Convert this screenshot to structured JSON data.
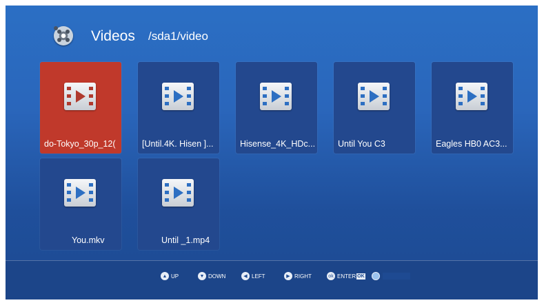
{
  "header": {
    "app_title": "Videos",
    "path": "/sda1/video",
    "logo_icon": "film-reel-icon"
  },
  "files": [
    {
      "name": "do-Tokyo_30p_12(",
      "selected": true
    },
    {
      "name": "[Until.4K. Hisen ]...",
      "selected": false
    },
    {
      "name": "Hisense_4K_HDc...",
      "selected": false
    },
    {
      "name": "Until You C3",
      "selected": false
    },
    {
      "name": "Eagles HB0 AC3...",
      "selected": false
    },
    {
      "name": "You.mkv",
      "selected": false
    },
    {
      "name": "Until _1.mp4",
      "selected": false
    }
  ],
  "footer": {
    "up": {
      "icon": "▲",
      "label": "UP"
    },
    "down": {
      "icon": "▼",
      "label": "DOWN"
    },
    "left": {
      "icon": "◀",
      "label": "LEFT"
    },
    "right": {
      "icon": "▶",
      "label": "RIGHT"
    },
    "enter": {
      "icon": "ok",
      "label": "ENTER",
      "badge": "OK"
    }
  },
  "colors": {
    "selected_tile": "#c0392b",
    "tile": "#23488e",
    "background": "#2a66bb"
  }
}
